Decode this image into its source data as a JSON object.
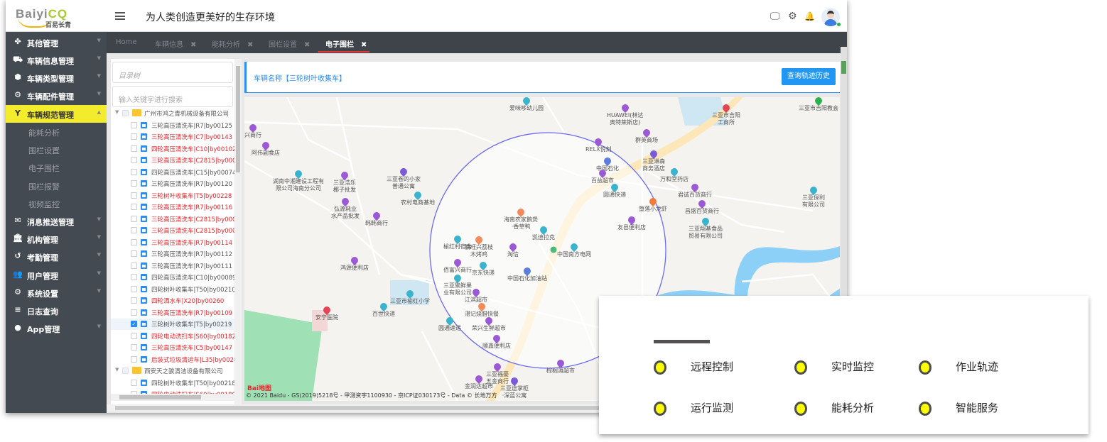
{
  "header": {
    "logo_text_a": "Baiyi",
    "logo_text_b": "CQ",
    "logo_sub": "百易长青",
    "slogan": "为人类创造更美好的生存环境",
    "icons": [
      "monitor-icon",
      "gear-icon",
      "bell-icon",
      "avatar"
    ]
  },
  "sidebar": {
    "items": [
      {
        "label": "其他管理",
        "icon": "cubes-icon",
        "glyph": "✤"
      },
      {
        "label": "车辆信息管理",
        "icon": "truck-icon",
        "glyph": "⛟"
      },
      {
        "label": "车辆类型管理",
        "icon": "cube-icon",
        "glyph": "⬢"
      },
      {
        "label": "车辆配件管理",
        "icon": "gear-icon",
        "glyph": "⚙"
      },
      {
        "label": "车辆规范管理",
        "icon": "filter-y-icon",
        "glyph": "Y",
        "active": true
      },
      {
        "label": "能耗分析",
        "sub": true
      },
      {
        "label": "围栏设置",
        "sub": true
      },
      {
        "label": "电子围栏",
        "sub": true
      },
      {
        "label": "围栏报警",
        "sub": true
      },
      {
        "label": "视频监控",
        "sub": true
      },
      {
        "label": "消息推送管理",
        "icon": "envelope-icon",
        "glyph": "✉"
      },
      {
        "label": "机构管理",
        "icon": "institution-icon",
        "glyph": "🏛"
      },
      {
        "label": "考勤管理",
        "icon": "history-icon",
        "glyph": "↺"
      },
      {
        "label": "用户管理",
        "icon": "users-icon",
        "glyph": "👥"
      },
      {
        "label": "系统设置",
        "icon": "gears-icon",
        "glyph": "⚙"
      },
      {
        "label": "日志查询",
        "icon": "list-icon",
        "glyph": "≡",
        "nocaret": true
      },
      {
        "label": "App管理",
        "icon": "android-icon",
        "glyph": "●"
      }
    ]
  },
  "tabs": [
    {
      "label": "Home"
    },
    {
      "label": "车辆信息",
      "close": "✖"
    },
    {
      "label": "能耗分析",
      "close": "✖"
    },
    {
      "label": "围栏设置",
      "close": "✖"
    },
    {
      "label": "电子围栏",
      "close": "✖",
      "active": true
    }
  ],
  "tree": {
    "placeholder_title": "目录树",
    "search_placeholder": "输入关键字进行搜索",
    "rows": [
      {
        "type": "company",
        "name": "广州市鸿之青机械设备有限公司"
      },
      {
        "name": "三轮高压清洗车|R7|by00125"
      },
      {
        "name": "三轮高压清洗车|C7|by00143",
        "alert": true
      },
      {
        "name": "四轮高压清洗车|C10|by00102",
        "alert": true
      },
      {
        "name": "三轮高压清洗车|C2815|by00017",
        "alert": true
      },
      {
        "name": "四轮高压清洗车|C15|by00074"
      },
      {
        "name": "三轮高压清洗车|R7|by00120"
      },
      {
        "name": "三轮树叶收集车|T5|by00228",
        "alert": true
      },
      {
        "name": "三轮高压清洗车|R7|by00116",
        "alert": true
      },
      {
        "name": "三轮高压清洗车|C2815|by00002",
        "alert": true
      },
      {
        "name": "三轮高压清洗车|C2815|by00031",
        "alert": true
      },
      {
        "name": "三轮高压清洗车|R7|by00114",
        "alert": true
      },
      {
        "name": "三轮高压清洗车|R7|by00112"
      },
      {
        "name": "三轮高压清洗车|R7|by00111"
      },
      {
        "name": "四轮高压清洗车|C10|by00089"
      },
      {
        "name": "四轮树叶收集车|T50|by00210"
      },
      {
        "name": "四轮洒水车|X20|by00260",
        "alert": true
      },
      {
        "name": "三轮高压清洗车|R7|by00109",
        "alert": true
      },
      {
        "name": "三轮树叶收集车|T5|by00219",
        "checked": true
      },
      {
        "name": "四轮电动洗扫车|S60|by00182",
        "alert": true
      },
      {
        "name": "三轮高压清洗车|C5|by00147",
        "alert": true
      },
      {
        "name": "后装式垃圾清运车|L35|by00280",
        "alert": true
      },
      {
        "type": "company",
        "name": "西安天之骏清洁设备有限公司"
      },
      {
        "name": "四轮树叶收集车|T50|by00218"
      },
      {
        "name": "四轮电动洗扫车|S60|by00189",
        "alert": true
      }
    ]
  },
  "map_header": {
    "vehicle_label": "车辆名称【三轮树叶收集车】",
    "query_button": "查询轨迹历史"
  },
  "map": {
    "pois": [
      "爱味哆幼儿园",
      "兴商行",
      "阿伟副食店",
      "湖南中湘建设工程有\n限公司海南分公司",
      "三亚浩乐\n椰子批发",
      "三亚卷的小家\n普通公寓",
      "农村电商基地",
      "弘源耗业\n水产品批发",
      "韩韩商行",
      "鸿源便利店",
      "三亚市榆红小学",
      "安宁医院",
      "百世快递",
      "海南农家鹅煲\n·香草鸭",
      "凯迪拉克",
      "鹏旺兴荔枝\n木烤鸡",
      "榆红村宿舍",
      "淘信",
      "中国南方电网",
      "佰富兴商行",
      "京东快递",
      "中国石化加油站",
      "三亚聚鲜果\n业有限公司",
      "江滨超市",
      "湛记烧腊快餐",
      "荣兴生鲜超市",
      "圆通速递",
      "顺鑫便利店",
      "三亚福豪\n五金商行",
      "棕榈滩超市",
      "金润达超市",
      "三亚途掌柜\n·深蓝公寓",
      "HUAWEI(林达\n奥特莱斯店)",
      "三亚市吉阳\n工商所",
      "群英商场",
      "RELX悦刻",
      "三亚淋森\n商务酒店",
      "中国石化",
      "百益超市",
      "万和堂药店",
      "君诚百货商行",
      "圆通快递",
      "堕落小龙虾",
      "昌盛百货商行",
      "友邑便利店",
      "三亚翔基食品\n贸易有限公司",
      "三亚市吉阳教会",
      "三亚保利\n有限公司"
    ],
    "copyright": "© 2021 Baidu - GS(2019)5218号 - 甲测资字1100930 - 京ICP证030173号 - Data © 长地万方",
    "brand": "Bai地图"
  },
  "features": {
    "items": [
      "远程控制",
      "实时监控",
      "作业轨迹",
      "运行监测",
      "能耗分析",
      "智能服务"
    ],
    "dot_color": "#ffff00"
  },
  "colors": {
    "sidebar": "#444a52",
    "accent": "#2d8cf0",
    "active_nav": "#f2ec2c",
    "alert_text": "#e8232a",
    "fence": "#6b6bf5"
  }
}
